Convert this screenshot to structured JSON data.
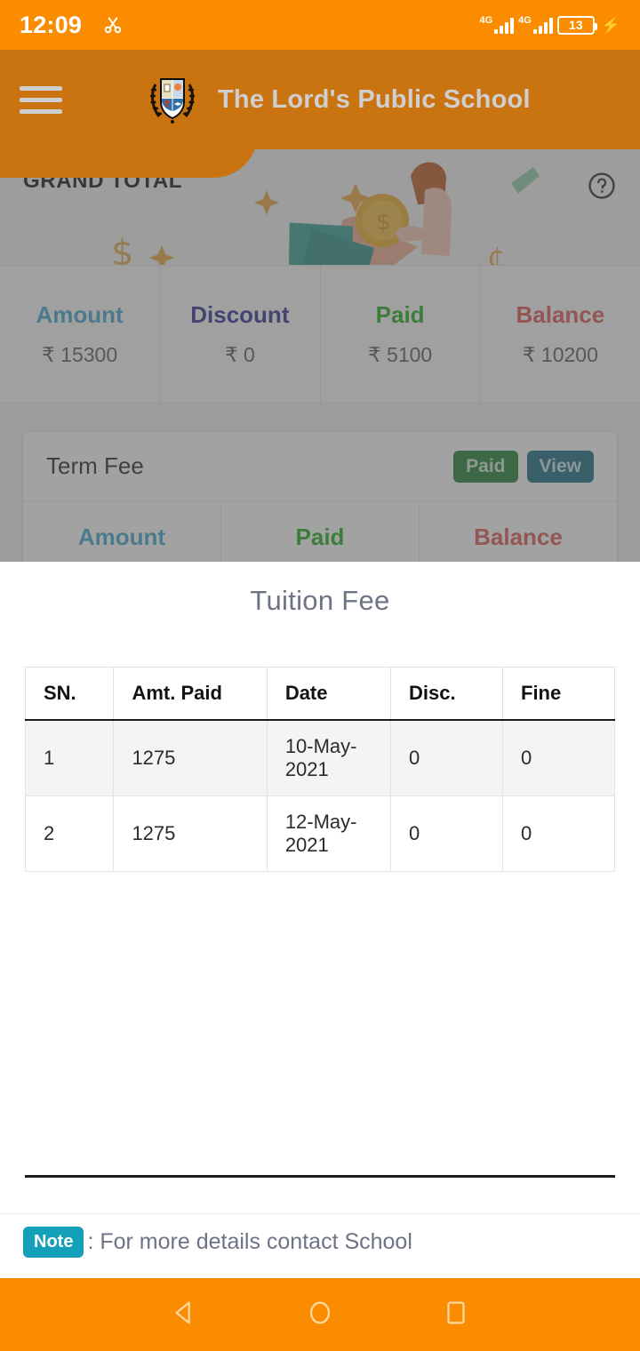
{
  "statusbar": {
    "time": "12:09",
    "screenshot_icon": "scissors-icon",
    "network_1": "4G",
    "network_2": "4G",
    "battery_level": "13",
    "charging_icon": "lightning-bolt-icon"
  },
  "appbar": {
    "menu_icon": "hamburger-menu-icon",
    "logo_icon": "school-crest-icon",
    "title": "The Lord's Public School"
  },
  "page": {
    "grand_total_label": "GRAND TOTAL",
    "help_icon": "question-mark-circle-icon",
    "summary": [
      {
        "label": "Amount",
        "currency": "₹",
        "value": "15300",
        "color": "#3ba3c9"
      },
      {
        "label": "Discount",
        "currency": "₹",
        "value": "0",
        "color": "#2b2b8f"
      },
      {
        "label": "Paid",
        "currency": "₹",
        "value": "5100",
        "color": "#1aa81a"
      },
      {
        "label": "Balance",
        "currency": "₹",
        "value": "10200",
        "color": "#d9534f"
      }
    ],
    "term_card": {
      "title": "Term Fee",
      "status_badge": "Paid",
      "view_button": "View",
      "columns": [
        {
          "label": "Amount",
          "color": "#3ba3c9"
        },
        {
          "label": "Paid",
          "color": "#1aa81a"
        },
        {
          "label": "Balance",
          "color": "#d9534f"
        }
      ]
    }
  },
  "sheet": {
    "title": "Tuition Fee",
    "table": {
      "headers": [
        "SN.",
        "Amt. Paid",
        "Date",
        "Disc.",
        "Fine"
      ],
      "rows": [
        [
          "1",
          "1275",
          "10-May-2021",
          "0",
          "0"
        ],
        [
          "2",
          "1275",
          "12-May-2021",
          "0",
          "0"
        ]
      ]
    },
    "note_badge": "Note",
    "note_text": ": For more details contact School"
  },
  "navbar": {
    "back": "back-triangle-icon",
    "home": "home-circle-icon",
    "recents": "recents-square-icon"
  },
  "colors": {
    "status_orange": "#fb8c00",
    "appbar_brown": "#c97410",
    "teal": "#14a0b8",
    "green": "#1a7a2e"
  }
}
